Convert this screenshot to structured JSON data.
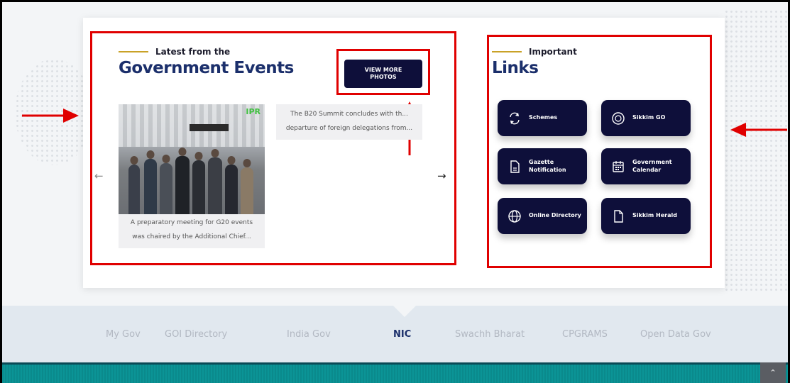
{
  "events": {
    "eyebrow": "Latest from the",
    "title": "Government Events",
    "view_more": "VIEW MORE\nPHOTOS",
    "photo_watermark": "IPR",
    "cards": [
      {
        "caption": "A preparatory meeting for G20 events\nwas chaired by the Additional Chief..."
      },
      {
        "caption": "The B20 Summit concludes with th...\ndeparture of foreign delegations from..."
      }
    ],
    "prev_icon": "arrow-left-icon",
    "next_icon": "arrow-right-icon"
  },
  "links": {
    "eyebrow": "Important",
    "title": "Links",
    "items": [
      {
        "label": "Schemes",
        "icon": "refresh-icon"
      },
      {
        "label": "Sikkim GO",
        "icon": "globe-icon"
      },
      {
        "label": "Gazette\nNotification",
        "icon": "document-icon"
      },
      {
        "label": "Government\nCalendar",
        "icon": "calendar-icon"
      },
      {
        "label": "Online Directory",
        "icon": "globe-icon"
      },
      {
        "label": "Sikkim Herald",
        "icon": "document-icon"
      }
    ]
  },
  "footer_links": [
    {
      "label": "My Gov",
      "active": false
    },
    {
      "label": "GOI Directory",
      "active": false
    },
    {
      "label": "India Gov",
      "active": false
    },
    {
      "label": "NIC",
      "active": true
    },
    {
      "label": "Swachh Bharat",
      "active": false
    },
    {
      "label": "CPGRAMS",
      "active": false
    },
    {
      "label": "Open Data Gov",
      "active": false
    }
  ],
  "scroll_top_icon": "chevron-up-icon",
  "colors": {
    "annotation_red": "#e00000",
    "navy": "#0e0f3a",
    "title_blue": "#1b2f6b",
    "accent_gold": "#c9a227",
    "teal_bar": "#0a8a8c"
  }
}
